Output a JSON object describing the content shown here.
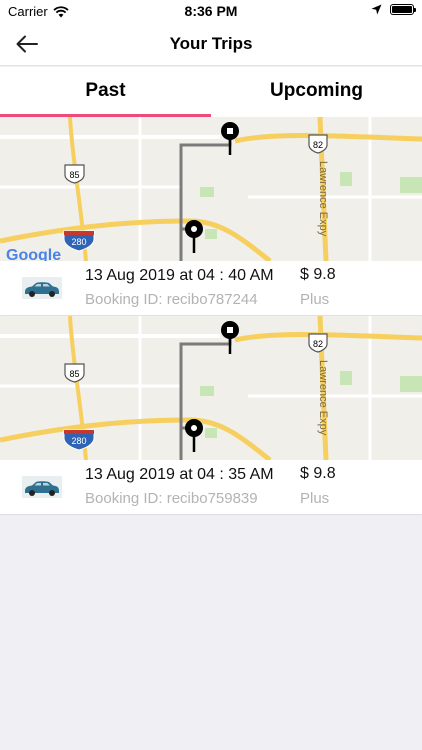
{
  "status_bar": {
    "carrier": "Carrier",
    "time": "8:36 PM"
  },
  "nav": {
    "title": "Your Trips"
  },
  "tabs": [
    {
      "label": "Past",
      "active": true
    },
    {
      "label": "Upcoming",
      "active": false
    }
  ],
  "map_labels": {
    "route_82": "82",
    "route_85": "85",
    "route_280": "280",
    "expressway": "Lawrence Expy",
    "google": "Google"
  },
  "trips": [
    {
      "date": "13 Aug 2019 at 04 : 40 AM",
      "booking_id": "Booking ID: recibo787244",
      "price": "$ 9.8",
      "car_type": "Plus"
    },
    {
      "date": "13 Aug 2019 at 04 : 35 AM",
      "booking_id": "Booking ID: recibo759839",
      "price": "$ 9.8",
      "car_type": "Plus"
    }
  ],
  "colors": {
    "accent": "#ee4b7b",
    "highway": "#f6cf5f",
    "car": "#2f6f8f"
  }
}
